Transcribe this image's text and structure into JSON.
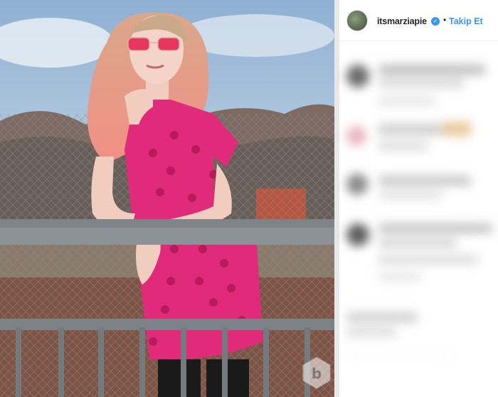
{
  "post": {
    "username": "itsmarziapie",
    "separator": "•",
    "follow_label": "Takip Et",
    "verified_icon": "verified-badge-icon"
  },
  "colors": {
    "accent": "#3897f0",
    "dress": "#e02b7a",
    "hair": "#f2a08a",
    "sky": "#a9c4dc"
  },
  "watermark": {
    "letter": "b"
  }
}
